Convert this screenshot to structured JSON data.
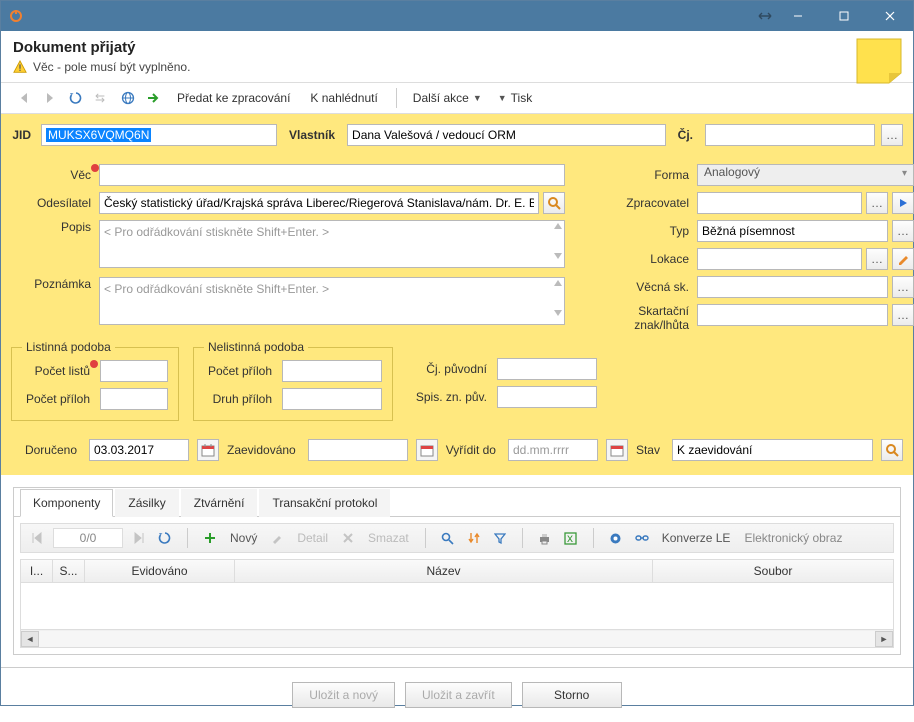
{
  "window": {
    "title": ""
  },
  "header": {
    "title": "Dokument přijatý",
    "warning": "Věc - pole musí být vyplněno."
  },
  "toolbar": {
    "predat": "Předat ke zpracování",
    "nahled": "K nahlédnutí",
    "dalsi": "Další akce",
    "tisk": "Tisk"
  },
  "row1": {
    "jid_label": "JID",
    "jid_value": "MUKSX6VQMQ6N",
    "vlastnik_label": "Vlastník",
    "vlastnik_value": "Dana Valešová / vedoucí ORM",
    "cj_label": "Čj."
  },
  "left": {
    "vec_label": "Věc",
    "odesilatel_label": "Odesílatel",
    "odesilatel_value": "Český statistický úřad/Krajská správa Liberec/Riegerová Stanislava/nám. Dr. E. Ben",
    "popis_label": "Popis",
    "popis_placeholder": "< Pro odřádkování stiskněte Shift+Enter. >",
    "poznamka_label": "Poznámka",
    "poznamka_placeholder": "< Pro odřádkování stiskněte Shift+Enter. >"
  },
  "right": {
    "forma_label": "Forma",
    "forma_value": "Analogový",
    "zpracovatel_label": "Zpracovatel",
    "typ_label": "Typ",
    "typ_value": "Běžná písemnost",
    "lokace_label": "Lokace",
    "vecna_label": "Věcná sk.",
    "skart_label": "Skartační znak/lhůta"
  },
  "groups": {
    "listinna_legend": "Listinná podoba",
    "pocet_listu": "Počet listů",
    "pocet_priloh": "Počet příloh",
    "nelistinna_legend": "Nelistinná podoba",
    "np_pocet_priloh": "Počet příloh",
    "druh_priloh": "Druh příloh",
    "cj_puvodni": "Čj. původní",
    "spis_zn": "Spis. zn. pův."
  },
  "dates": {
    "doruceno_label": "Doručeno",
    "doruceno_value": "03.03.2017",
    "zaevidovano_label": "Zaevidováno",
    "vyridit_label": "Vyřídit do",
    "vyridit_placeholder": "dd.mm.rrrr",
    "stav_label": "Stav",
    "stav_value": "K zaevidování"
  },
  "tabs": {
    "t1": "Komponenty",
    "t2": "Zásilky",
    "t3": "Ztvárnění",
    "t4": "Transakční protokol"
  },
  "subtoolbar": {
    "counter": "0/0",
    "novy": "Nový",
    "detail": "Detail",
    "smazat": "Smazat",
    "konverze": "Konverze LE",
    "elobraz": "Elektronický obraz"
  },
  "table": {
    "col_i": "I...",
    "col_s": "S...",
    "col_evidovano": "Evidováno",
    "col_nazev": "Název",
    "col_soubor": "Soubor"
  },
  "footer": {
    "save_new": "Uložit a nový",
    "save_close": "Uložit a zavřít",
    "storno": "Storno"
  }
}
